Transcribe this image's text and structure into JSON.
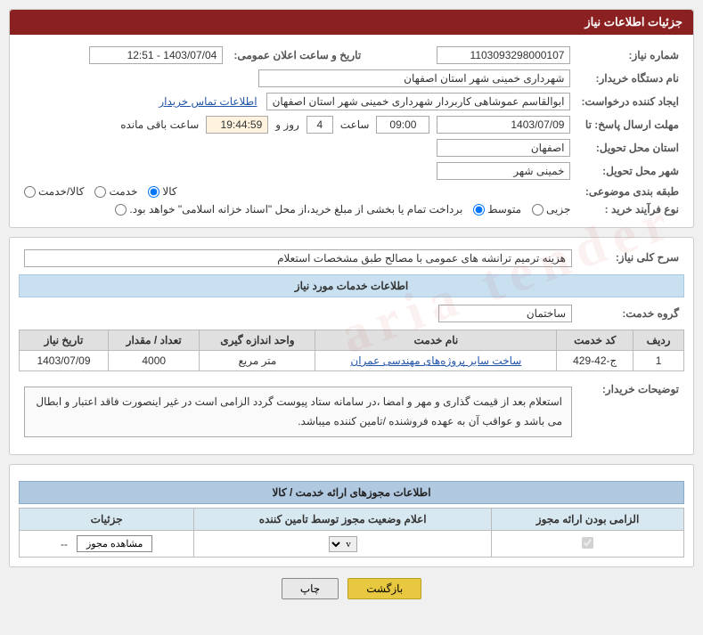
{
  "page": {
    "title": "جزئیات اطلاعات نیاز",
    "watermark": "aria tender"
  },
  "header_section": {
    "label_request_number": "شماره نیاز:",
    "request_number": "1103093298000107",
    "label_date": "تاریخ و ساعت اعلان عمومی:",
    "date": "1403/07/04 - 12:51",
    "label_buyer": "نام دستگاه خریدار:",
    "buyer": "شهرداری خمینی شهر استان اصفهان",
    "label_creator": "ایجاد کننده درخواست:",
    "creator": "ابوالقاسم عموشاهی کاربردار شهرداری خمینی شهر استان اصفهان",
    "creator_contact_link": "اطلاعات تماس خریدار",
    "label_reply_deadline": "مهلت ارسال پاسخ: تا",
    "deadline_date": "1403/07/09",
    "deadline_time": "09:00",
    "deadline_days": "4",
    "deadline_hours": "19:44:59",
    "deadline_days_label": "روز و",
    "deadline_hours_label": "ساعت باقی مانده",
    "label_delivery_province": "استان محل تحویل:",
    "delivery_province": "اصفهان",
    "label_delivery_city": "شهر محل تحویل:",
    "delivery_city": "خمینی شهر",
    "label_category": "طبقه بندی موضوعی:",
    "category_options": [
      {
        "label": "کالا",
        "selected": true
      },
      {
        "label": "خدمت",
        "selected": false
      },
      {
        "label": "کالا/خدمت",
        "selected": false
      }
    ],
    "label_purchase_type": "نوع فرآیند خرید :",
    "purchase_type_options": [
      {
        "label": "جزیی",
        "selected": false
      },
      {
        "label": "متوسط",
        "selected": true
      },
      {
        "label": "برداخت تمام یا بخشی از مبلغ خرید،از محل \"اسناد خزانه اسلامی\" خواهد بود.",
        "selected": false
      }
    ]
  },
  "description_section": {
    "header": "سرح کلی نیاز:",
    "text": "هزینه ترمیم ترانشه های عمومی با مصالح طبق مشخصات استعلام"
  },
  "service_info_section": {
    "header": "اطلاعات خدمات مورد نیاز",
    "label_service_group": "گروه خدمت:",
    "service_group": "ساختمان",
    "table_headers": [
      "ردیف",
      "کد خدمت",
      "نام خدمت",
      "واحد اندازه گیری",
      "تعداد / مقدار",
      "تاریخ نیاز"
    ],
    "table_rows": [
      {
        "row": "1",
        "code": "ج-42-429",
        "service": "ساخت سایر پروژه های مهندسی عمران",
        "unit": "متر مریع",
        "quantity": "4000",
        "date": "1403/07/09"
      }
    ]
  },
  "buyer_notes_section": {
    "label": "توضیحات خریدار:",
    "text": "استعلام بعد از قیمت گذاری و مهر و امضا ،در سامانه ستاد پیوست گردد الزامی است در غیر اینصورت فاقد اعتبار و ابطال می باشد و عواقب آن به عهده فروشنده /تامین کننده میباشد."
  },
  "attachments_section": {
    "header": "اطلاعات مجوزهای ارائه خدمت / کالا",
    "table_headers": [
      "الزامی بودن ارائه مجوز",
      "اعلام وضعیت مجوز توسط تامین کننده",
      "جزئیات"
    ],
    "table_rows": [
      {
        "required": true,
        "status_value": "v",
        "detail_value": "--",
        "view_btn": "مشاهده مجوز"
      }
    ]
  },
  "action_buttons": {
    "print_label": "چاپ",
    "back_label": "بازگشت"
  }
}
